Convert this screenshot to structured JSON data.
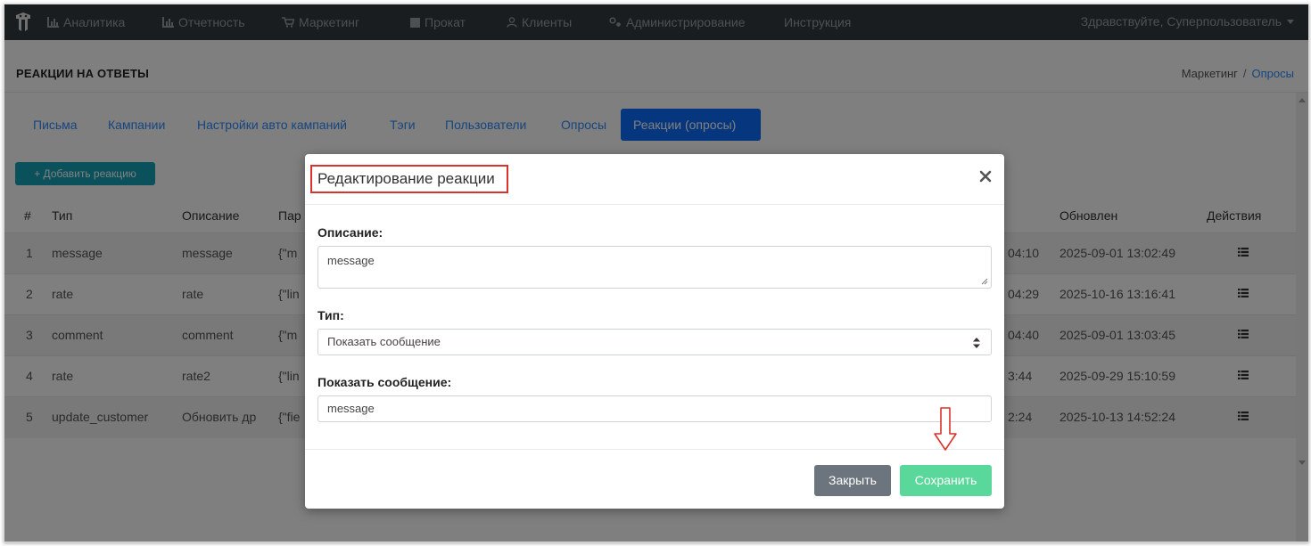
{
  "navbar": {
    "items": [
      {
        "label": "Аналитика",
        "icon": "chart-icon"
      },
      {
        "label": "Отчетность",
        "icon": "chart-icon"
      },
      {
        "label": "Маркетинг",
        "icon": "cart-icon"
      },
      {
        "label": "Прокат",
        "icon": "square-icon"
      },
      {
        "label": "Клиенты",
        "icon": "user-icon"
      },
      {
        "label": "Администрирование",
        "icon": "gears-icon"
      },
      {
        "label": "Инструкция",
        "icon": ""
      }
    ],
    "user_greeting": "Здравствуйте, Суперпользователь"
  },
  "header": {
    "title": "РЕАКЦИИ НА ОТВЕТЫ",
    "breadcrumb": [
      "Маркетинг",
      "/",
      "Опросы"
    ]
  },
  "tabs": [
    {
      "label": "Письма"
    },
    {
      "label": "Кампании"
    },
    {
      "label": "Настройки авто кампаний"
    },
    {
      "label": "Тэги"
    },
    {
      "label": "Пользователи"
    },
    {
      "label": "Опросы"
    },
    {
      "label": "Реакции (опросы)",
      "active": true
    }
  ],
  "add_button": "+ Добавить реакцию",
  "table": {
    "columns": [
      "#",
      "Тип",
      "Описание",
      "Пар",
      "Обновлен",
      "Действия"
    ],
    "rows": [
      {
        "num": "1",
        "type": "message",
        "desc": "message",
        "params": "{\"m",
        "created_tail": "04:10",
        "updated": "2025-09-01 13:02:49"
      },
      {
        "num": "2",
        "type": "rate",
        "desc": "rate",
        "params": "{\"lin",
        "created_tail": "04:29",
        "updated": "2025-10-16 13:16:41"
      },
      {
        "num": "3",
        "type": "comment",
        "desc": "comment",
        "params": "{\"m",
        "created_tail": "04:40",
        "updated": "2025-09-01 13:03:45"
      },
      {
        "num": "4",
        "type": "rate",
        "desc": "rate2",
        "params": "{\"lin",
        "created_tail": "3:44",
        "updated": "2025-09-29 15:10:59"
      },
      {
        "num": "5",
        "type": "update_customer",
        "desc": "Обновить др",
        "params": "{\"fie",
        "created_tail": "2:24",
        "updated": "2025-10-13 14:52:24"
      }
    ]
  },
  "modal": {
    "title": "Редактирование реакции",
    "description_label": "Описание:",
    "description_value": "message",
    "type_label": "Тип:",
    "type_value": "Показать сообщение",
    "message_label": "Показать сообщение:",
    "message_value": "message",
    "close_button": "Закрыть",
    "save_button": "Сохранить"
  },
  "colors": {
    "navbar": "#343a40",
    "primary": "#0d6efd",
    "info": "#17a2b8",
    "secondary": "#6c757d",
    "success_light": "#5ad89b",
    "annotation_red": "#d9342b"
  }
}
